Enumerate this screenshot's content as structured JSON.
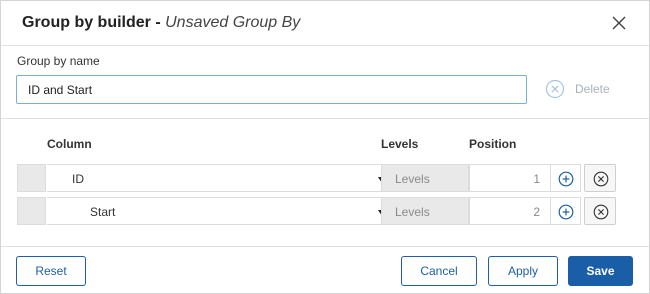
{
  "dialog": {
    "title": "Group by builder",
    "title_separator": " - ",
    "subtitle": "Unsaved Group By"
  },
  "name_field": {
    "label": "Group by name",
    "value": "ID and Start"
  },
  "delete": {
    "label": "Delete"
  },
  "columns": {
    "column": "Column",
    "levels": "Levels",
    "position": "Position"
  },
  "rows": [
    {
      "column": "ID",
      "levels": "Levels",
      "position": "1"
    },
    {
      "column": "Start",
      "levels": "Levels",
      "position": "2"
    }
  ],
  "footer": {
    "reset": "Reset",
    "cancel": "Cancel",
    "apply": "Apply",
    "save": "Save"
  },
  "colors": {
    "accent": "#1a5ea8",
    "input_focus_border": "#7aaee0",
    "disabled_text": "#a8b0b8"
  },
  "icons": {
    "close": "close-x-icon",
    "delete": "circle-x-icon",
    "add": "plus-circle-icon",
    "remove": "circle-x-icon",
    "dropdown": "caret-down-icon"
  }
}
